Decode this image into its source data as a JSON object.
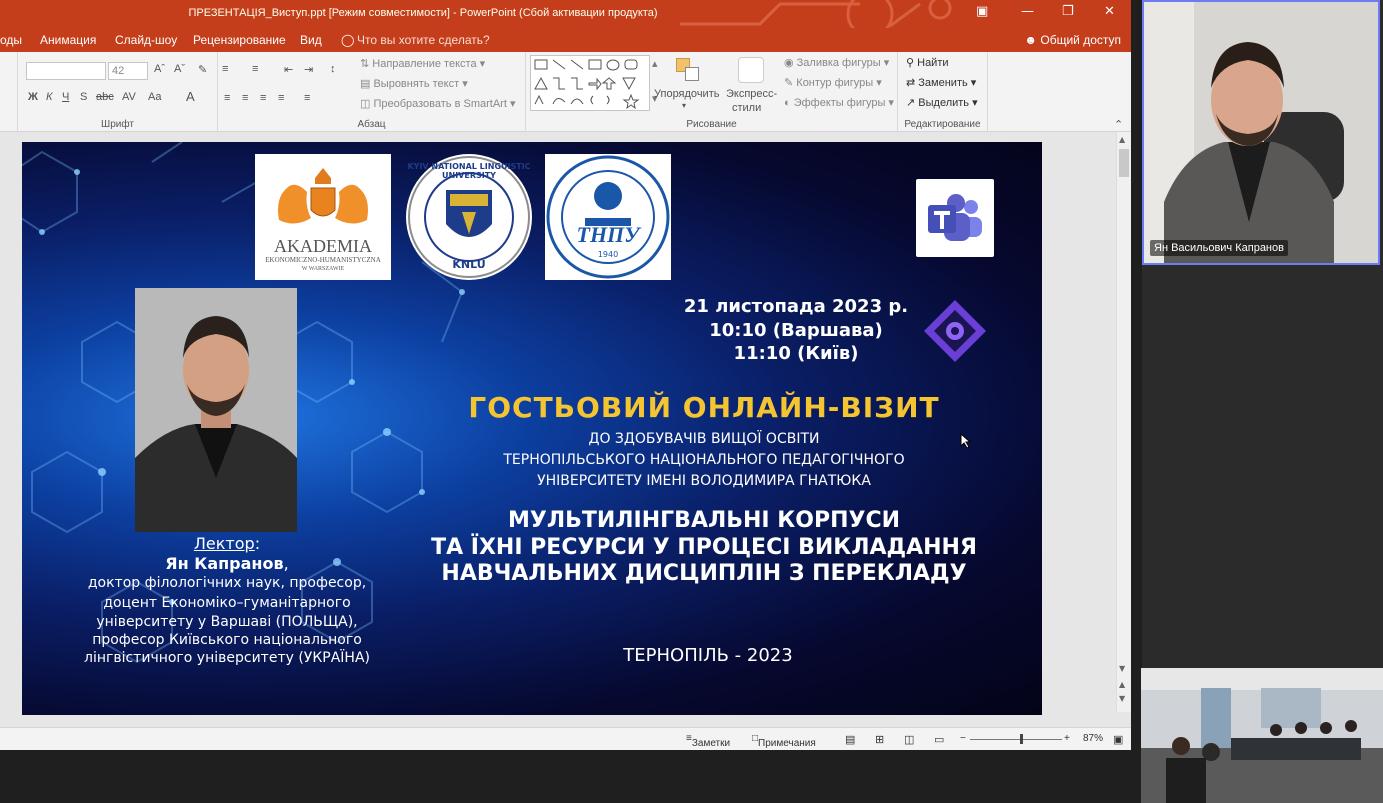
{
  "window": {
    "title": "ПРЕЗЕНТАЦІЯ_Виступ.ppt [Режим совместимости] - PowerPoint (Сбой активации продукта)"
  },
  "menu": {
    "items": [
      "оды",
      "Анимация",
      "Слайд-шоу",
      "Рецензирование",
      "Вид"
    ],
    "tell_me": "Что вы хотите сделать?",
    "share": "Общий доступ"
  },
  "ribbon": {
    "font_size": "42",
    "groups": {
      "font": "Шрифт",
      "paragraph": "Абзац",
      "drawing": "Рисование",
      "editing": "Редактирование"
    },
    "paragraph": {
      "text_direction": "Направление текста",
      "align_text": "Выровнять текст",
      "smartart": "Преобразовать в SmartArt"
    },
    "drawing": {
      "arrange": "Упорядочить",
      "quick_styles_1": "Экспресс-",
      "quick_styles_2": "стили",
      "fill": "Заливка фигуры",
      "outline": "Контур фигуры",
      "effects": "Эффекты фигуры"
    },
    "editing": {
      "find": "Найти",
      "replace": "Заменить",
      "select": "Выделить"
    }
  },
  "slide": {
    "logos": {
      "akademia": "AKADEMIA",
      "akademia_sub": "EKONOMICZNO-HUMANISTYCZNA",
      "akademia_city": "W WARSZAWIE",
      "knlu_ring": "KYIV NATIONAL LINGUISTIC UNIVERSITY",
      "knlu": "KNLU",
      "tnpu": "ТНПУ",
      "tnpu_year": "1940"
    },
    "date": "21 листопада 2023 р.",
    "time_warsaw": "10:10 (Варшава)",
    "time_kyiv": "11:10 (Київ)",
    "headline": "ГОСТЬОВИЙ ОНЛАЙН-ВІЗИТ",
    "sub1": "ДО ЗДОБУВАЧІВ ВИЩОЇ ОСВІТИ",
    "sub2": "ТЕРНОПІЛЬСЬКОГО НАЦІОНАЛЬНОГО ПЕДАГОГІЧНОГО",
    "sub3": "УНІВЕРСИТЕТУ ІМЕНІ ВОЛОДИМИРА ГНАТЮКА",
    "topic1": "МУЛЬТИЛІНГВАЛЬНІ КОРПУСИ",
    "topic2": "ТА ЇХНІ РЕСУРСИ У ПРОЦЕСІ ВИКЛАДАННЯ",
    "topic3": "НАВЧАЛЬНИХ ДИСЦИПЛІН З ПЕРЕКЛАДУ",
    "city_year": "ТЕРНОПІЛЬ - 2023",
    "lecturer_label": "Лектор",
    "lecturer_colon": ":",
    "lecturer_name": "Ян Капранов",
    "lecturer_comma": ",",
    "bio1": "доктор філологічних наук, професор,",
    "bio2": "доцент Економіко–гуманітарного",
    "bio3": "університету у Варшаві (ПОЛЬЩА),",
    "bio4": "професор Київського національного",
    "bio5": "лінгвістичного університету (УКРАЇНА)"
  },
  "status": {
    "notes": "Заметки",
    "comments": "Примечания",
    "zoom": "87%",
    "zoom_level": 0.55
  },
  "video": {
    "participant_name": "Ян Васильович Капранов"
  },
  "colors": {
    "accent": "#c43e1c",
    "headline": "#f5c431",
    "teams": "#5b5fc7"
  }
}
